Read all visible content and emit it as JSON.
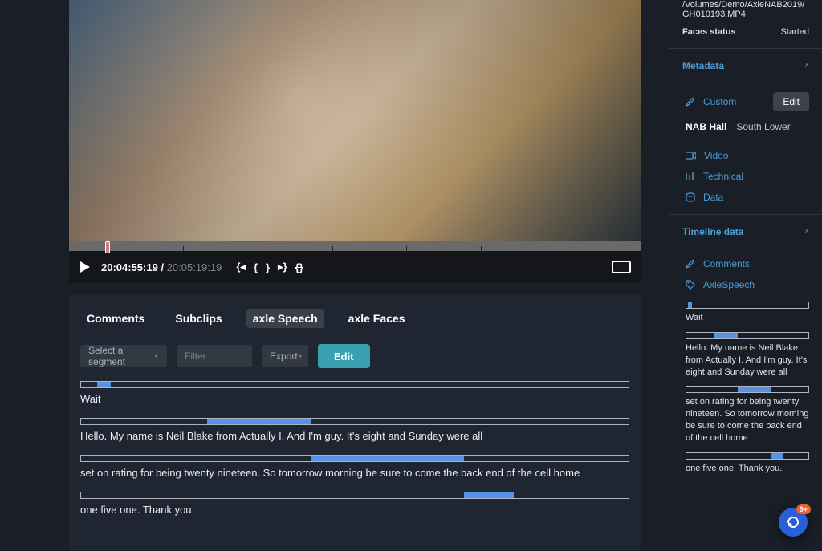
{
  "video": {
    "currentTime": "20:04:55:19",
    "totalTime": "20:05:19:19"
  },
  "tabs": {
    "comments": "Comments",
    "subclips": "Subclips",
    "axleSpeech": "axle Speech",
    "axleFaces": "axle Faces"
  },
  "toolbar": {
    "selectSegment": "Select a segment",
    "filterPlaceholder": "Filter",
    "export": "Export",
    "edit": "Edit"
  },
  "segments": [
    {
      "text": "Wait",
      "start": 3,
      "width": 2.4
    },
    {
      "text": "Hello. My name is Neil Blake from Actually I. And I'm guy. It's eight and Sunday were all",
      "start": 23,
      "width": 19
    },
    {
      "text": "set on rating for being twenty nineteen. So tomorrow morning be sure to come the back end of the cell home",
      "start": 42,
      "width": 28
    },
    {
      "text": "one five one. Thank you.",
      "start": 70,
      "width": 9
    }
  ],
  "file": {
    "path": "/Volumes/Demo/AxleNAB2019/GH0",
    "path2": "10193.MP4",
    "facesStatusLabel": "Faces status",
    "facesStatusValue": "Started"
  },
  "sidebar": {
    "metadata": "Metadata",
    "custom": "Custom",
    "editLabel": "Edit",
    "hallKey": "NAB Hall",
    "hallVal": "South Lower",
    "video": "Video",
    "technical": "Technical",
    "data": "Data",
    "timelineData": "Timeline data",
    "commentsItem": "Comments",
    "axleSpeechItem": "AxleSpeech"
  },
  "sideSegments": [
    {
      "text": "Wait",
      "start": 1.5,
      "width": 3
    },
    {
      "text": "Hello. My name is Neil Blake from Actually I. And I'm guy. It's eight and Sunday were all",
      "start": 23,
      "width": 19
    },
    {
      "text": "set on rating for being twenty nineteen. So tomorrow morning be sure to come the back end of the cell home",
      "start": 42,
      "width": 28
    },
    {
      "text": "one five one. Thank you.",
      "start": 70,
      "width": 9
    }
  ],
  "fab": {
    "badge": "9+"
  }
}
